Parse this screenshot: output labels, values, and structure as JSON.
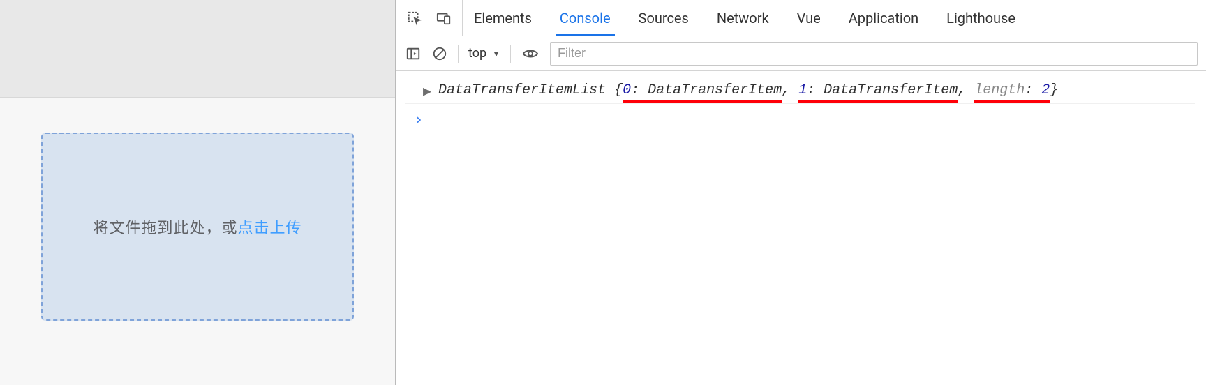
{
  "leftPane": {
    "upload": {
      "textBefore": "将文件拖到此处，或",
      "linkText": "点击上传"
    }
  },
  "devtools": {
    "tabs": {
      "items": [
        {
          "label": "Elements",
          "active": false
        },
        {
          "label": "Console",
          "active": true
        },
        {
          "label": "Sources",
          "active": false
        },
        {
          "label": "Network",
          "active": false
        },
        {
          "label": "Vue",
          "active": false
        },
        {
          "label": "Application",
          "active": false
        },
        {
          "label": "Lighthouse",
          "active": false
        }
      ]
    },
    "toolbar": {
      "context": "top",
      "filterPlaceholder": "Filter"
    },
    "log": {
      "className": "DataTransferItemList",
      "brace_open": " {",
      "brace_close": "}",
      "entries": [
        {
          "key": "0",
          "value": "DataTransferItem"
        },
        {
          "key": "1",
          "value": "DataTransferItem"
        }
      ],
      "lengthLabel": "length",
      "lengthValue": "2"
    },
    "prompt": "›"
  }
}
